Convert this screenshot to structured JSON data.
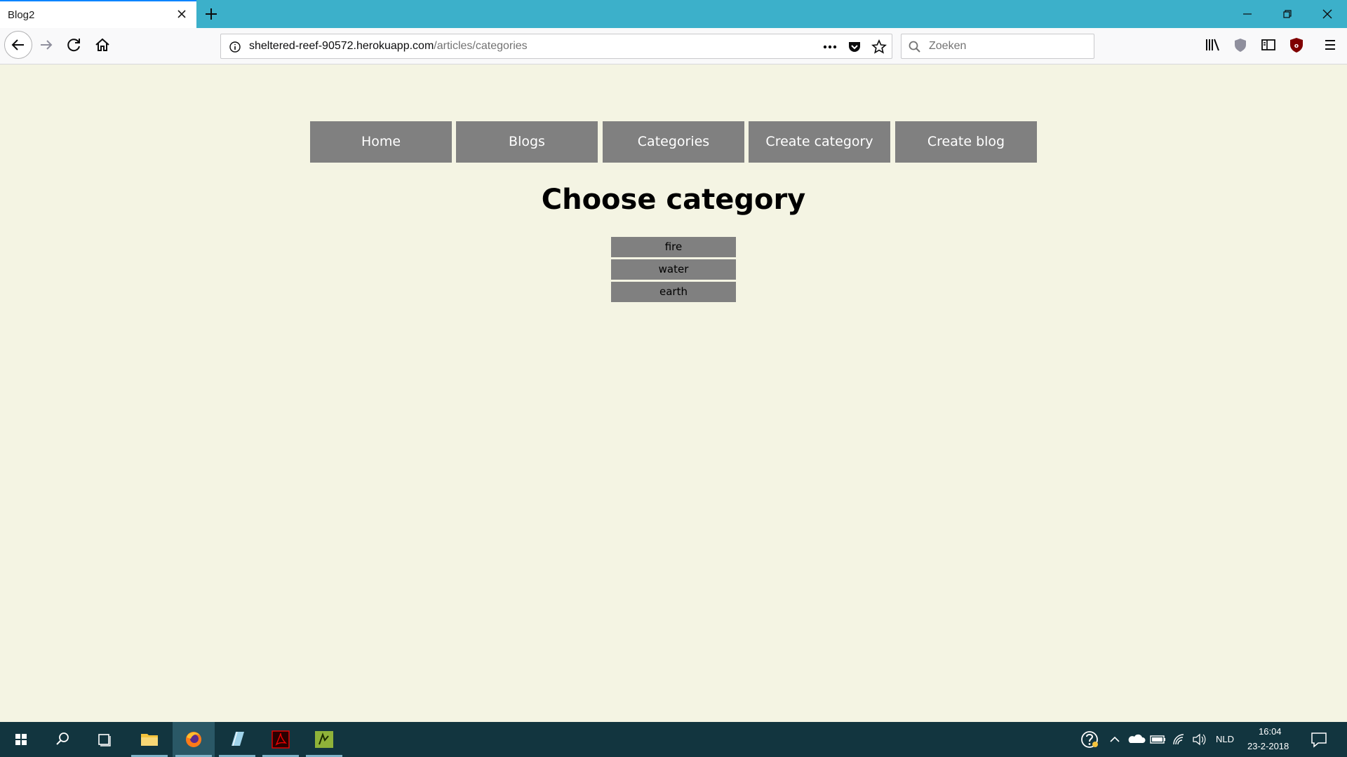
{
  "browser": {
    "tab_title": "Blog2",
    "url_host": "sheltered-reef-90572.herokuapp.com",
    "url_path": "/articles/categories",
    "search_placeholder": "Zoeken"
  },
  "nav": {
    "items": [
      {
        "label": "Home"
      },
      {
        "label": "Blogs"
      },
      {
        "label": "Categories"
      },
      {
        "label": "Create category"
      },
      {
        "label": "Create blog"
      }
    ]
  },
  "main": {
    "heading": "Choose category",
    "categories": [
      {
        "label": "fire"
      },
      {
        "label": "water"
      },
      {
        "label": "earth"
      }
    ]
  },
  "taskbar": {
    "language": "NLD",
    "time": "16:04",
    "date": "23-2-2018"
  },
  "colors": {
    "page_background": "#f4f4e3",
    "button_gray": "#808080",
    "titlebar": "#3cb0ca",
    "taskbar": "#12353f"
  }
}
